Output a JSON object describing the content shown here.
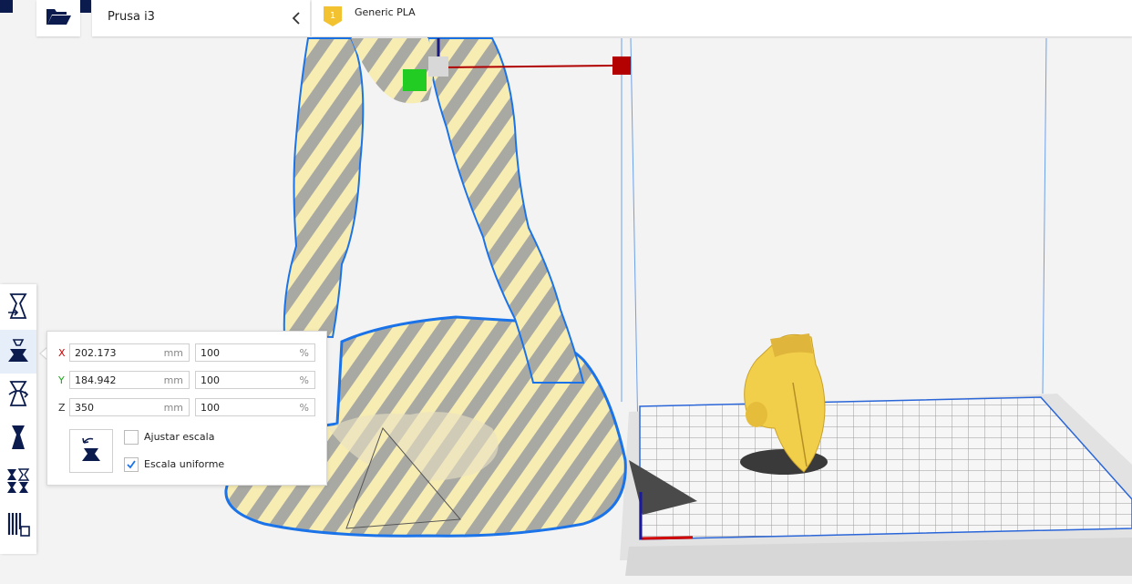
{
  "header": {
    "printer_name": "Prusa i3",
    "extruder_number": "1",
    "material_name": "Generic PLA"
  },
  "icons": {
    "open": "folder-open-icon",
    "collapse": "chevron-left-icon",
    "tools": [
      "move-tool-icon",
      "scale-tool-icon",
      "rotate-tool-icon",
      "mirror-tool-icon",
      "per-model-settings-icon",
      "support-blocker-icon"
    ]
  },
  "scale_panel": {
    "x": {
      "axis": "X",
      "mm": "202.173",
      "mm_unit": "mm",
      "percent": "100",
      "percent_unit": "%"
    },
    "y": {
      "axis": "Y",
      "mm": "184.942",
      "mm_unit": "mm",
      "percent": "100",
      "percent_unit": "%"
    },
    "z": {
      "axis": "Z",
      "mm": "350",
      "mm_unit": "mm",
      "percent": "100",
      "percent_unit": "%"
    },
    "snap_scaling": {
      "label": "Ajustar escala",
      "checked": false
    },
    "uniform_scaling": {
      "label": "Escala uniforme",
      "checked": true
    }
  },
  "colors": {
    "axis_x": "#d00000",
    "axis_y": "#1ca41c",
    "axis_z": "#1a1a80",
    "accent": "#0b1b4d",
    "badge": "#f2c230",
    "model_yellow": "#f7e9a6",
    "model_stripe": "#9c9c9c",
    "helmet": "#f2cf4a",
    "selection_outline": "#1a73e8"
  }
}
